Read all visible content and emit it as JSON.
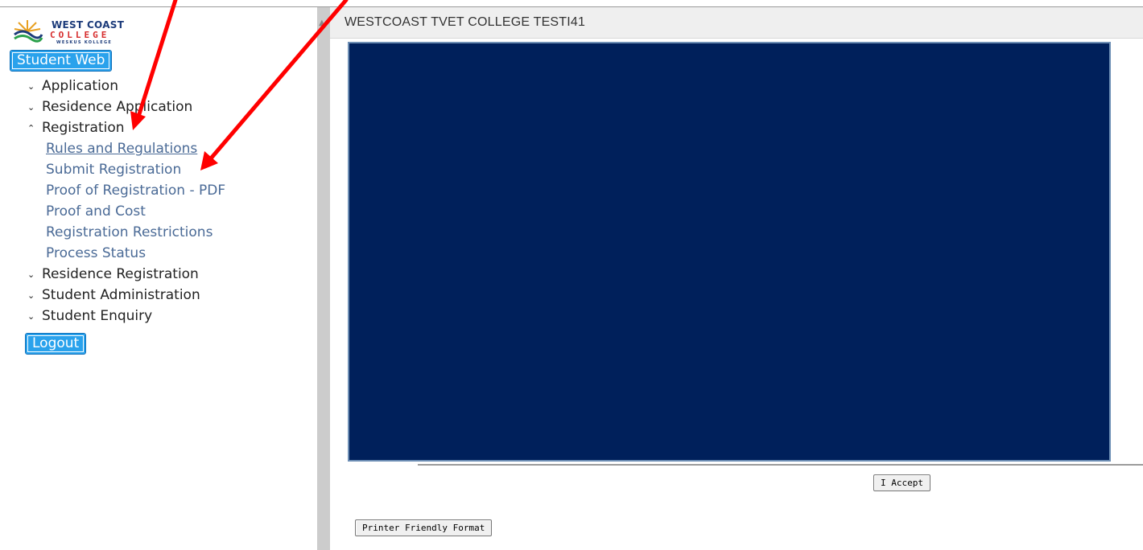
{
  "colors": {
    "accent_button": "#2aa2ec",
    "content_panel": "#00205b",
    "link": "#4a6a96",
    "annotation_arrow": "#ff0000"
  },
  "logo": {
    "line1": "WEST COAST",
    "line2": "COLLEGE",
    "line3": "WESKUS KOLLEGE",
    "icon": "college-logo-icon"
  },
  "sidebar": {
    "student_web_label": "Student Web",
    "logout_label": "Logout",
    "menu": [
      {
        "type": "toggle",
        "icon": "chevron-down-icon",
        "chevron": "⌄",
        "label": "Application"
      },
      {
        "type": "toggle",
        "icon": "chevron-down-icon",
        "chevron": "⌄",
        "label": "Residence Application"
      },
      {
        "type": "toggle",
        "icon": "chevron-up-icon",
        "chevron": "⌃",
        "label": "Registration",
        "expanded": true
      },
      {
        "type": "link",
        "label": "Rules and Regulations",
        "underlined": true
      },
      {
        "type": "link",
        "label": "Submit Registration"
      },
      {
        "type": "link",
        "label": "Proof of Registration - PDF"
      },
      {
        "type": "link",
        "label": "Proof and Cost"
      },
      {
        "type": "link",
        "label": "Registration Restrictions"
      },
      {
        "type": "link",
        "label": "Process Status"
      },
      {
        "type": "toggle",
        "icon": "chevron-down-icon",
        "chevron": "⌄",
        "label": "Residence Registration"
      },
      {
        "type": "toggle",
        "icon": "chevron-down-icon",
        "chevron": "⌄",
        "label": "Student Administration"
      },
      {
        "type": "toggle",
        "icon": "chevron-down-icon",
        "chevron": "⌄",
        "label": "Student Enquiry"
      }
    ]
  },
  "main": {
    "header_title": "WESTCOAST TVET COLLEGE TESTI41",
    "accept_label": "I Accept",
    "printer_friendly_label": "Printer Friendly Format"
  }
}
